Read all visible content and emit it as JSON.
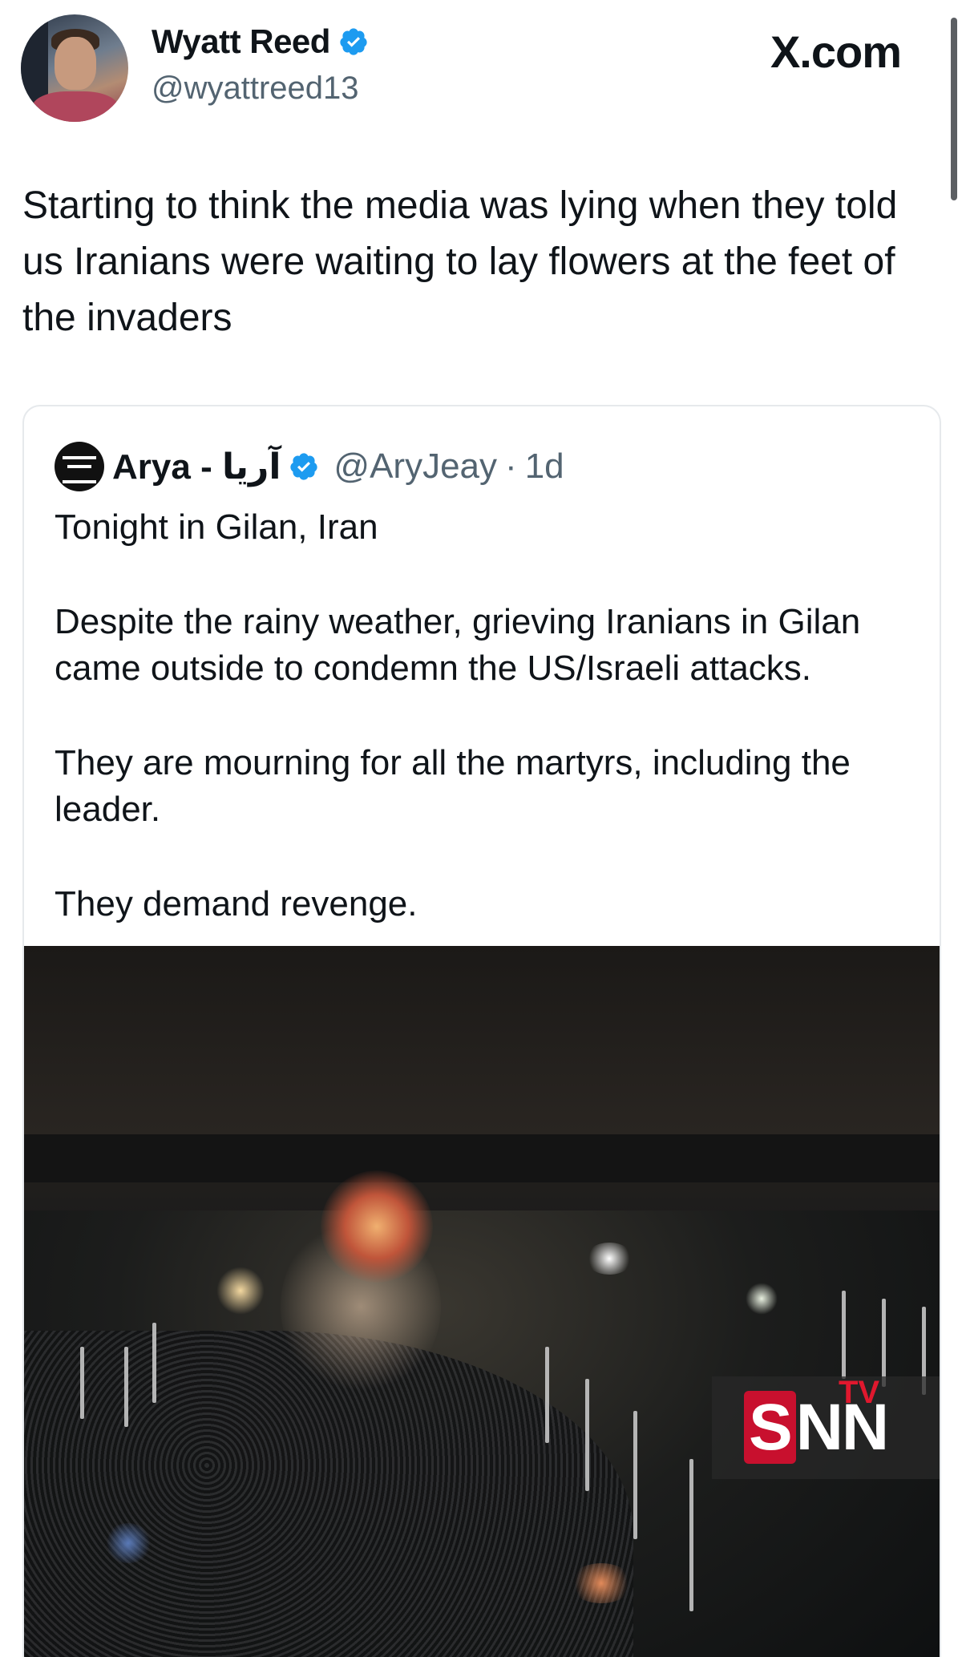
{
  "header": {
    "display_name": "Wyatt Reed",
    "handle": "@wyattreed13",
    "site_label": "X.com",
    "verified_icon": "verified-badge-icon"
  },
  "tweet": {
    "text": "Starting to think the media was lying when they told us Iranians were waiting to lay flowers at the feet of the invaders"
  },
  "quoted_tweet": {
    "display_name": "Arya - آریا",
    "handle": "@AryJeay",
    "separator": "·",
    "time": "1d",
    "paragraphs": [
      "Tonight in Gilan, Iran",
      "Despite the rainy weather, grieving Iranians in Gilan came outside to condemn the US/Israeli attacks.",
      "They are mourning for all the martyrs, including the leader.",
      "They demand revenge."
    ]
  },
  "watermark": {
    "brand_s": "S",
    "brand_rest": "NN",
    "brand_tv": "TV"
  },
  "colors": {
    "verified_blue": "#1d9bf0",
    "secondary_text": "#536471",
    "watermark_red": "#c8102e"
  }
}
